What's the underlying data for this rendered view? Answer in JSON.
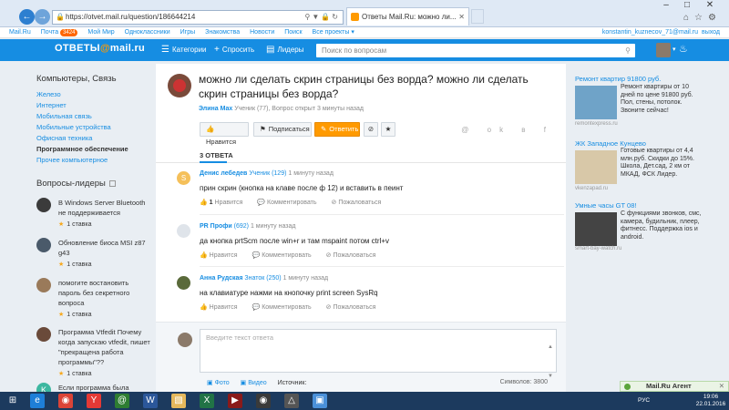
{
  "browser": {
    "url": "https://otvet.mail.ru/question/186644214",
    "tab_title": "Ответы Mail.Ru: можно ли...",
    "back_icon": "arrow-left-icon",
    "forward_icon": "arrow-right-icon"
  },
  "portal": {
    "links": [
      "Mail.Ru",
      "Почта",
      "Мой Мир",
      "Одноклассники",
      "Игры",
      "Знакомства",
      "Новости",
      "Поиск",
      "Все проекты"
    ],
    "mail_badge": "3424",
    "user_email": "konstantin_kuznecov_71@mail.ru",
    "logout": "выход"
  },
  "header": {
    "logo_main": "ОТВЕТЫ",
    "logo_at": "@",
    "logo_domain": "mail.ru",
    "categories": "Категории",
    "ask": "Спросить",
    "leaders": "Лидеры",
    "search_placeholder": "Поиск по вопросам"
  },
  "sidebar": {
    "title": "Компьютеры, Связь",
    "links": [
      {
        "label": "Железо",
        "active": false
      },
      {
        "label": "Интернет",
        "active": false
      },
      {
        "label": "Мобильная связь",
        "active": false
      },
      {
        "label": "Мобильные устройства",
        "active": false
      },
      {
        "label": "Офисная техника",
        "active": false
      },
      {
        "label": "Программное обеспечение",
        "active": true
      },
      {
        "label": "Прочее компьютерное",
        "active": false
      }
    ],
    "leaders_title": "Вопросы-лидеры",
    "leaders": [
      {
        "question": "В Windows Server Bluetooth не поддерживается",
        "stakes": "1 ставка",
        "color": "#3b3b3b"
      },
      {
        "question": "Обновление биоса MSI z87 g43",
        "stakes": "1 ставка",
        "color": "#4a5a6a"
      },
      {
        "question": "помогите востановить пароль без секретного вопроса",
        "stakes": "1 ставка",
        "color": "#9a7a5a"
      },
      {
        "question": "Программа Vtfedit Почему когда запускаю vtfedit, пишет \"прекращена работа программы\"??",
        "stakes": "1 ставка",
        "color": "#6a4a3a"
      },
      {
        "question": "Если программа была",
        "stakes": "",
        "color": "#3cb7a0",
        "letter": "K"
      }
    ]
  },
  "question": {
    "title": "можно ли сделать скрин страницы без ворда? можно ли сделать скрин страницы без ворда?",
    "author": "Элина Max",
    "author_rank": "Ученик (77)",
    "meta_rest": ", Вопрос открыт 3 минуты назад",
    "like": "Нравится",
    "subscribe": "Подписаться",
    "answer": "Ответить",
    "share_icons": "@ ok в f"
  },
  "answers_count": "3 ОТВЕТА",
  "answers": [
    {
      "author": "Денис лебедев",
      "rank": "Ученик (129)",
      "time": "1 минуту назад",
      "text": "прин скрин (кнопка на клаве после ф 12) и вставить в пеинт",
      "likes": "1",
      "like_label": "Нравится",
      "comment_label": "Комментировать",
      "complain_label": "Пожаловаться",
      "avatar_color": "#f5c05a",
      "avatar_letter": "S"
    },
    {
      "author": "PR Профи",
      "rank": "(692)",
      "time": "1 минуту назад",
      "text": "да кнопка prtScm после win+r и там mspaint потом ctrl+v",
      "likes": "",
      "like_label": "Нравится",
      "comment_label": "Комментировать",
      "complain_label": "Пожаловаться",
      "avatar_color": "#dfe4ea",
      "avatar_letter": ""
    },
    {
      "author": "Анна Рудская",
      "rank": "Знаток (250)",
      "time": "1 минуту назад",
      "text": "на клавиатуре нажми на кнопочку print screen SysRq",
      "likes": "",
      "like_label": "Нравится",
      "comment_label": "Комментировать",
      "complain_label": "Пожаловаться",
      "avatar_color": "#5a6a3a",
      "avatar_letter": ""
    }
  ],
  "reply": {
    "placeholder": "Введите текст ответа",
    "photo": "Фото",
    "video": "Видео",
    "sources": "Источник:",
    "chars": "Символов: 3800"
  },
  "ads": [
    {
      "title": "Ремонт квартир 91800 руб.",
      "text": "Ремонт квартиры от 10 дней по цене 91800 руб. Пол, стены, потолок. Звоните сейчас!",
      "source": "remontexpress.ru",
      "color": "#6fa3c8"
    },
    {
      "title": "ЖК Западное Кунцево",
      "text": "Готовые квартиры от 4,4 млн.руб. Скидки до 15%. Школа, Дет.сад, 2 км от МКАД, ФСК Лидер.",
      "source": "vkenzapad.ru",
      "color": "#d8c8a8"
    },
    {
      "title": "Умные часы GT 08!",
      "text": "С функциями звонков, смс, камера, будильник, плеер, фитнесс. Поддержка ios и android.",
      "source": "smart-bay-watch.ru",
      "color": "#444444"
    }
  ],
  "agent": {
    "label": "Mail.Ru Агент"
  },
  "taskbar": {
    "lang": "РУС",
    "time": "19:06",
    "date": "22.01.2016"
  }
}
